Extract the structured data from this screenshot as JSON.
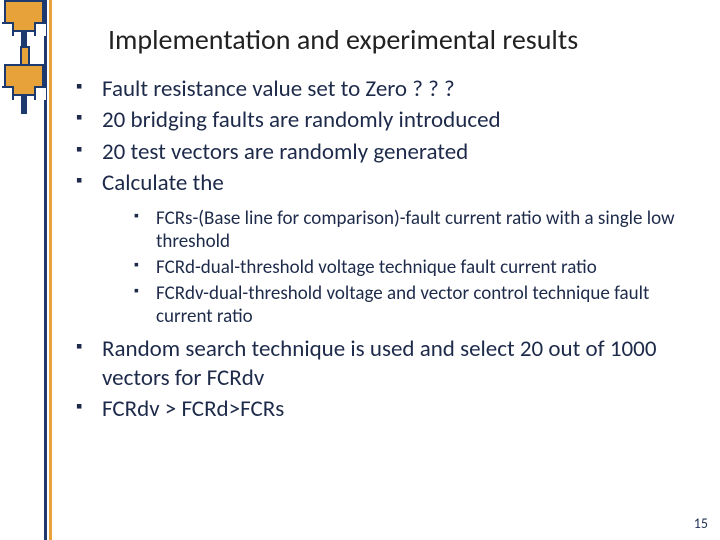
{
  "title": "Implementation and experimental results",
  "bullets": {
    "b1": "Fault resistance value set to Zero ? ? ?",
    "b2": "20 bridging faults are randomly introduced",
    "b3": "20 test vectors are randomly generated",
    "b4": "Calculate the",
    "sub": {
      "s1": "FCRs-(Base line for comparison)-fault current ratio with a single low threshold",
      "s2": "FCRd-dual-threshold voltage technique fault current ratio",
      "s3": "FCRdv-dual-threshold voltage and vector control technique fault current ratio"
    },
    "b5": "Random search technique is used and select 20 out of 1000 vectors for FCRdv",
    "b6": "FCRdv > FCRd>FCRs"
  },
  "page_number": "15"
}
